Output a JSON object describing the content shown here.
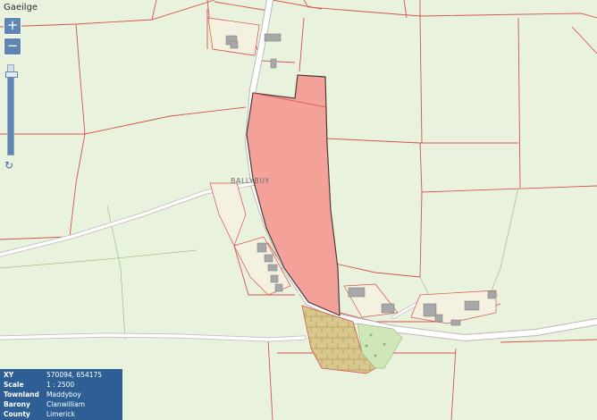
{
  "map": {
    "language_link": "Gaeilge",
    "zoom_in_symbol": "+",
    "zoom_out_symbol": "−",
    "zoom_level_fraction": 0.9,
    "refresh_icon": "refresh-icon",
    "place_label": "BALLYBUY",
    "colors": {
      "background": "#e9f2dc",
      "parcel_boundary": "#d4534f",
      "road": "#ffffff",
      "road_edge": "#b9b9b9",
      "highlight_fill": "#f4a19a",
      "highlight_edge": "#4a3b3b",
      "building": "#a8a8a8",
      "hatch": "#d9c88e",
      "woodland": "#cfe7b8",
      "panel": "#2d5f95"
    }
  },
  "info": {
    "rows": [
      {
        "label": "XY",
        "value": "570094, 654175"
      },
      {
        "label": "Scale",
        "value": "1 : 2500"
      },
      {
        "label": "Townland",
        "value": "Maddyboy"
      },
      {
        "label": "Barony",
        "value": "Clanwilliam"
      },
      {
        "label": "County",
        "value": "Limerick"
      }
    ]
  }
}
